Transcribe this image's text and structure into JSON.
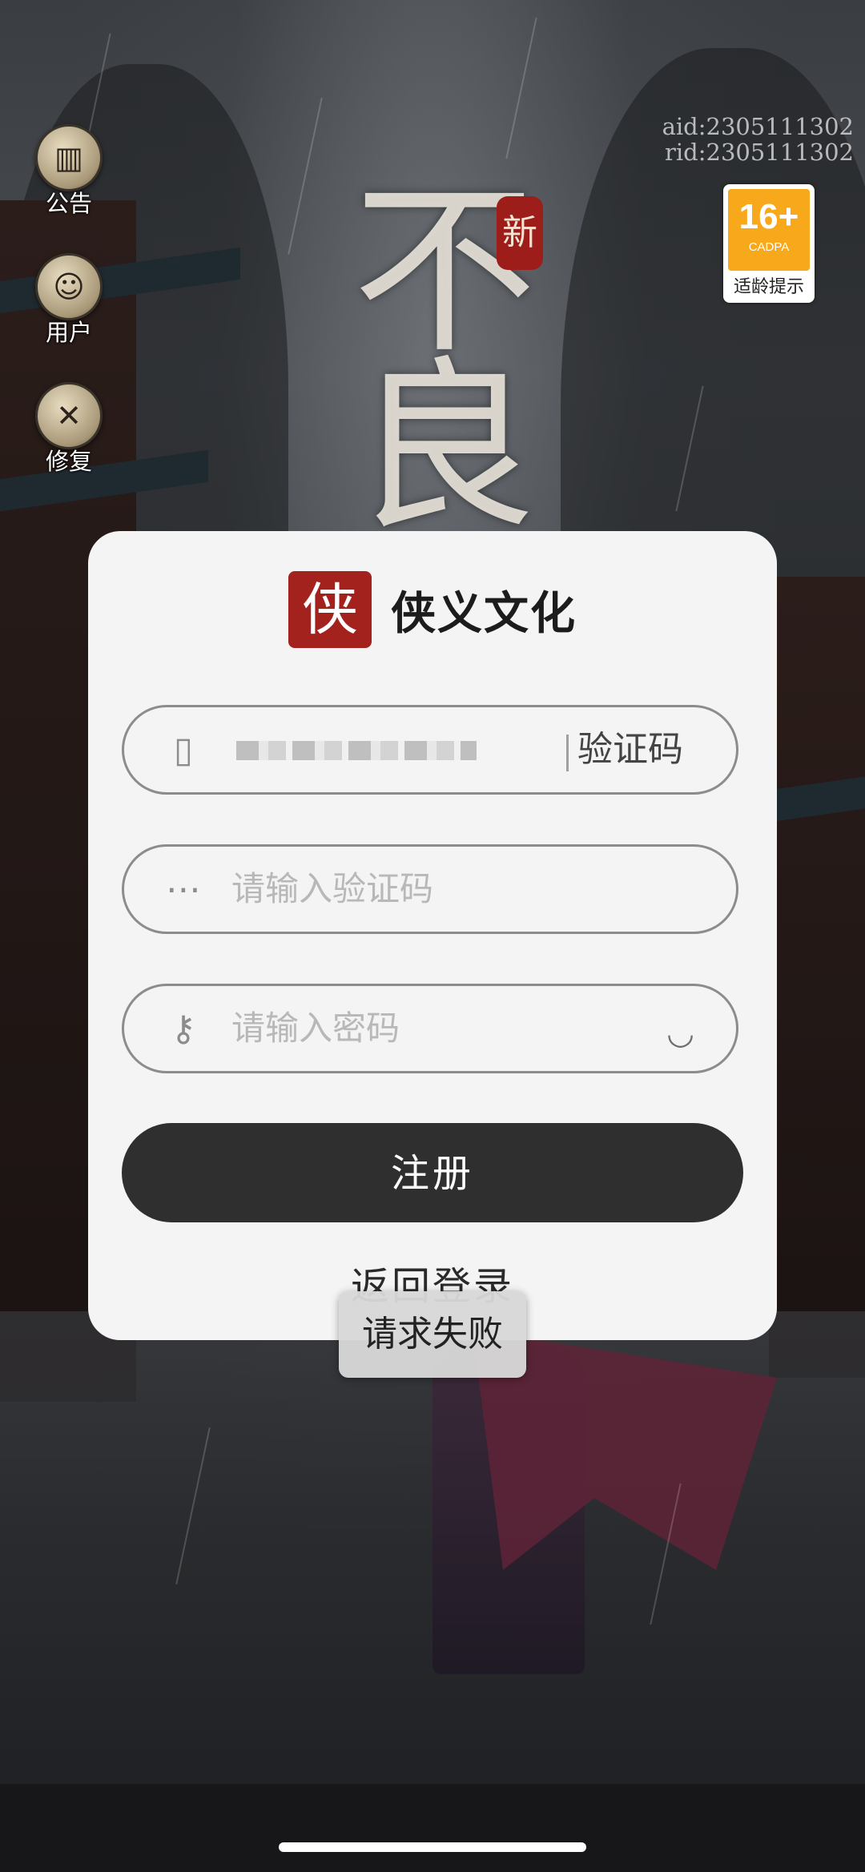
{
  "side_menu": [
    {
      "label": "公告",
      "icon": "scroll-icon"
    },
    {
      "label": "用户",
      "icon": "user-avatar-icon"
    },
    {
      "label": "修复",
      "icon": "wrench-icon"
    }
  ],
  "ids": {
    "aid": "aid:2305111302",
    "rid": "rid:2305111302"
  },
  "age_rating": {
    "number": "16+",
    "org": "CADPA",
    "tip": "适龄提示",
    "color": "#f7a81b"
  },
  "game_title_art": {
    "seal": "新",
    "chars": "不良"
  },
  "dialog": {
    "brand_seal": "侠",
    "brand_name": "侠义文化",
    "phone_field": {
      "icon": "phone-icon",
      "get_code_label": "验证码"
    },
    "code_field": {
      "icon": "code-icon",
      "placeholder": "请输入验证码"
    },
    "password_field": {
      "icon": "key-icon",
      "placeholder": "请输入密码",
      "toggle_icon": "eye-closed-icon"
    },
    "register_label": "注册",
    "back_label": "返回登录"
  },
  "toast": "请求失败",
  "colors": {
    "dialog_bg": "#f4f4f4",
    "primary_button": "#2f2f2f",
    "brand_red": "#a3221d"
  }
}
